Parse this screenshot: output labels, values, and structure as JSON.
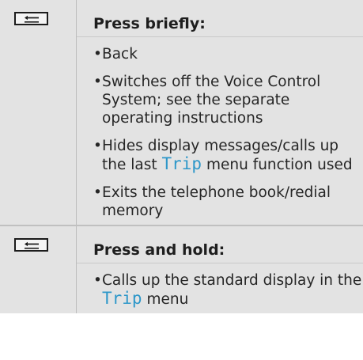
{
  "rows": [
    {
      "key_icon": "back-key-icon",
      "heading": "Press briefly:",
      "items": [
        {
          "parts": [
            {
              "t": "Back"
            }
          ]
        },
        {
          "parts": [
            {
              "t": "Switches off the Voice Control System; see the separate operating instructions"
            }
          ]
        },
        {
          "parts": [
            {
              "t": "Hides display messages/calls up the last "
            },
            {
              "t": "Trip",
              "mono": true
            },
            {
              "t": " menu function used"
            }
          ]
        },
        {
          "parts": [
            {
              "t": "Exits the telephone book/redial memory"
            }
          ]
        }
      ]
    },
    {
      "key_icon": "back-key-icon",
      "heading": "Press and hold:",
      "items": [
        {
          "parts": [
            {
              "t": "Calls up the standard display in the "
            },
            {
              "t": "Trip",
              "mono": true
            },
            {
              "t": " menu"
            }
          ]
        }
      ]
    }
  ],
  "colors": {
    "background": "#e3e3e3",
    "highlight_text": "#2d97c9",
    "border": "#bdbdbd"
  }
}
